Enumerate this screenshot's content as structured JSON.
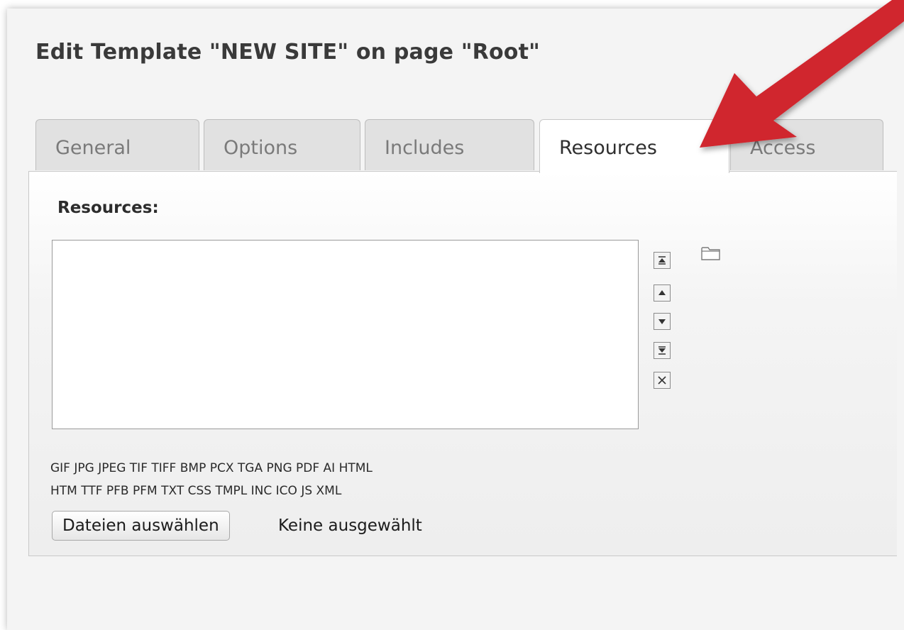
{
  "page": {
    "title": "Edit Template \"NEW SITE\" on page \"Root\""
  },
  "tabs": [
    {
      "label": "General",
      "active": false
    },
    {
      "label": "Options",
      "active": false
    },
    {
      "label": "Includes",
      "active": false
    },
    {
      "label": "Resources",
      "active": true
    },
    {
      "label": "Access",
      "active": false
    }
  ],
  "resources": {
    "section_label": "Resources:",
    "list_items": [],
    "controls": [
      {
        "icon": "move-to-top-icon"
      },
      {
        "icon": "move-up-icon"
      },
      {
        "icon": "move-down-icon"
      },
      {
        "icon": "move-to-bottom-icon"
      },
      {
        "icon": "remove-icon"
      }
    ],
    "browse_icon": "folder-icon",
    "allowed_types_line1": "GIF JPG JPEG TIF TIFF BMP PCX TGA PNG PDF AI HTML",
    "allowed_types_line2": "HTM TTF PFB PFM TXT CSS TMPL INC ICO JS XML",
    "file_button_label": "Dateien auswählen",
    "file_status": "Keine ausgewählt"
  },
  "annotation": {
    "arrow_color": "#d0262f",
    "arrow_points_to": "Resources"
  }
}
